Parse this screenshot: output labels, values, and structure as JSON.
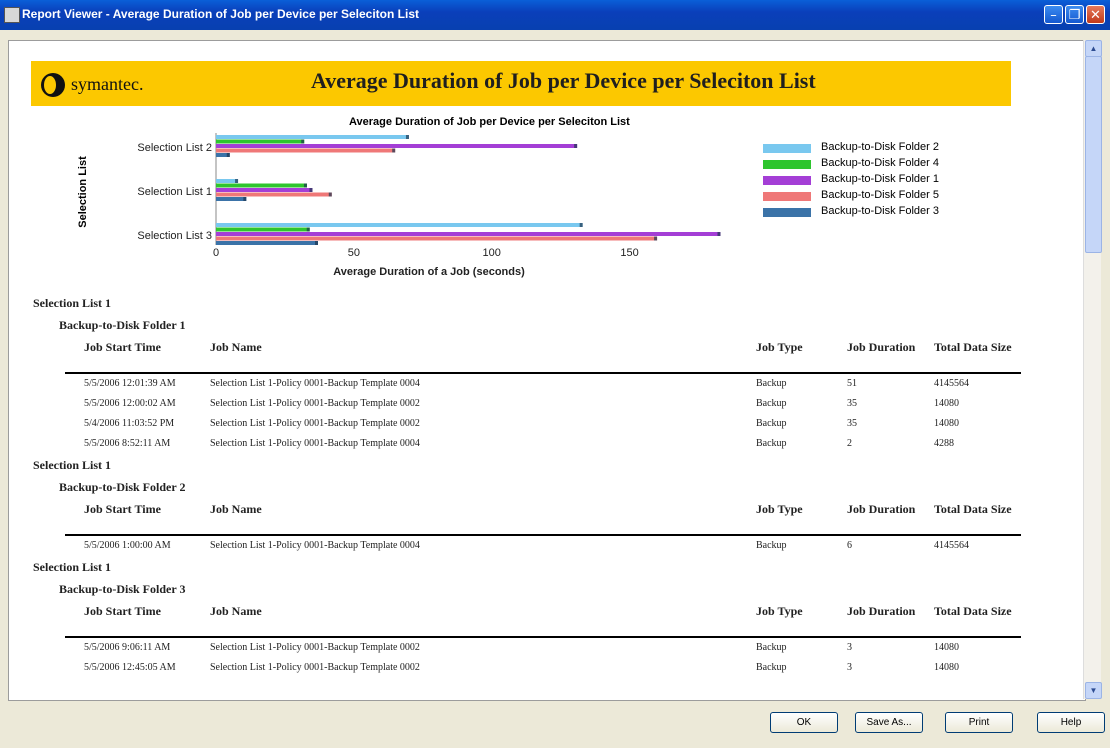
{
  "window": {
    "title": "Report Viewer - Average Duration of Job per Device per Seleciton List"
  },
  "banner": {
    "logo_text": "symantec.",
    "title": "Average Duration of Job per Device per Seleciton List"
  },
  "chart_data": {
    "type": "bar",
    "orientation": "horizontal",
    "title": "Average Duration of Job per Device per Seleciton List",
    "xlabel": "Average Duration of a Job (seconds)",
    "ylabel": "Selection List",
    "categories": [
      "Selection List 2",
      "Selection List 1",
      "Selection List 3"
    ],
    "xticks": [
      0,
      50,
      100,
      150
    ],
    "xlim": [
      0,
      185
    ],
    "series": [
      {
        "name": "Backup-to-Disk Folder 2",
        "color": "#79c8ef",
        "values": [
          70,
          8,
          133
        ]
      },
      {
        "name": "Backup-to-Disk Folder 4",
        "color": "#2ec52e",
        "values": [
          32,
          33,
          34
        ]
      },
      {
        "name": "Backup-to-Disk Folder 1",
        "color": "#a43ed6",
        "values": [
          131,
          35,
          183
        ]
      },
      {
        "name": "Backup-to-Disk Folder 5",
        "color": "#ef7878",
        "values": [
          65,
          42,
          160
        ]
      },
      {
        "name": "Backup-to-Disk Folder 3",
        "color": "#3b73a8",
        "values": [
          5,
          11,
          37
        ]
      }
    ],
    "legend_position": "right"
  },
  "columns": [
    "Job Start Time",
    "Job Name",
    "Job Type",
    "Job Duration",
    "Total Data Size"
  ],
  "groups": [
    {
      "selection": "Selection List 1",
      "folder": "Backup-to-Disk Folder 1",
      "rows": [
        [
          "5/5/2006 12:01:39 AM",
          "Selection List 1-Policy 0001-Backup Template 0004",
          "Backup",
          "51",
          "4145564"
        ],
        [
          "5/5/2006 12:00:02 AM",
          "Selection List 1-Policy 0001-Backup Template 0002",
          "Backup",
          "35",
          "14080"
        ],
        [
          "5/4/2006 11:03:52 PM",
          "Selection List 1-Policy 0001-Backup Template 0002",
          "Backup",
          "35",
          "14080"
        ],
        [
          "5/5/2006 8:52:11 AM",
          "Selection List 1-Policy 0001-Backup Template 0004",
          "Backup",
          "2",
          "4288"
        ]
      ]
    },
    {
      "selection": "Selection List 1",
      "folder": "Backup-to-Disk Folder 2",
      "rows": [
        [
          "5/5/2006 1:00:00 AM",
          "Selection List 1-Policy 0001-Backup Template 0004",
          "Backup",
          "6",
          "4145564"
        ]
      ]
    },
    {
      "selection": "Selection List 1",
      "folder": "Backup-to-Disk Folder 3",
      "rows": [
        [
          "5/5/2006 9:06:11 AM",
          "Selection List 1-Policy 0001-Backup Template 0002",
          "Backup",
          "3",
          "14080"
        ],
        [
          "5/5/2006 12:45:05 AM",
          "Selection List 1-Policy 0001-Backup Template 0002",
          "Backup",
          "3",
          "14080"
        ]
      ]
    }
  ],
  "buttons": {
    "ok": "OK",
    "save_as": "Save As...",
    "print": "Print",
    "help": "Help"
  },
  "colors": {
    "banner": "#fcc800",
    "titlebar": "#0a3fba"
  }
}
